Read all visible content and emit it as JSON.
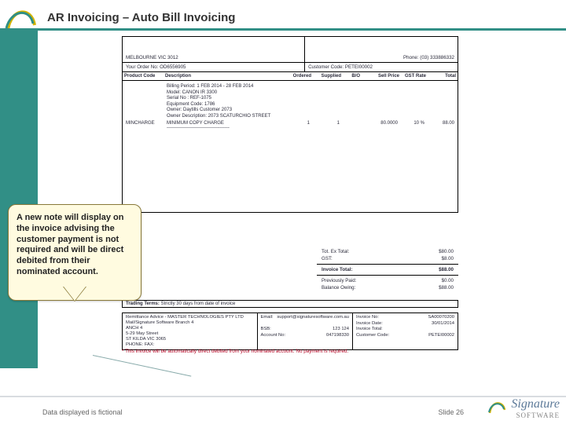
{
  "header": {
    "title": "AR Invoicing – Auto Bill Invoicing"
  },
  "invoice": {
    "melb_line": "MELBOURNE  VIC  3012",
    "phone": "Phone: (03) 333886332",
    "order_no_label": "Your Order No:",
    "order_no": "OD6556905",
    "cust_code_label": "Customer Code:",
    "cust_code": "PETEI00002",
    "cols": {
      "code": "Product Code",
      "desc": "Description",
      "ord": "Ordered",
      "sup": "Supplied",
      "bo": "B/O",
      "sell": "Sell Price",
      "gst": "GST Rate",
      "tot": "Total"
    },
    "detail": {
      "billing_period": "Billing Period: 1 FEB 2014 - 28 FEB 2014",
      "model": "Model: CANON IR 3300",
      "serial": "Serial No : REF-1075",
      "equip": "Equipment Code: 1786",
      "owner": "Owner: Daytills Customer 2073",
      "owner_desc": "Owner Description: 2073 SCATURCHIO STREET",
      "min_code": "MINCHARGE",
      "min_desc": "MINIMUM COPY CHARGE",
      "ord": "1",
      "sup": "1",
      "bo": "",
      "sell": "80.0000",
      "gst": "10 %",
      "tot": "88.00",
      "dashes": "----------------------------------------"
    },
    "totals": {
      "exgst_l": "Tot. Ex Total:",
      "exgst_v": "$80.00",
      "gst_l": "GST:",
      "gst_v": "$8.00",
      "invtot_l": "Invoice Total:",
      "invtot_v": "$88.00",
      "paid_l": "Previously Paid:",
      "paid_v": "$0.00",
      "owe_l": "Balance Owing:",
      "owe_v": "$88.00"
    },
    "terms_l": "Trading Terms:",
    "terms_v": "Strictly 30 days from date of invoice",
    "footer_left": {
      "l1": "Remittance Advice - MASTER TECHNOLOGIES PTY LTD",
      "l2": "Mail/Signature Software Branch 4",
      "l3": "ANCH 4",
      "l4": "5-29 May Street",
      "l5": "ST KILDA  VIC  3065",
      "l6": "PHONE:  FAX:"
    },
    "footer_mid": {
      "email_l": "Email:",
      "email_v": "support@signaturesoftware.com.au",
      "bsb_l": "BSB:",
      "bsb_v": "123 124",
      "acct_l": "Account No:",
      "acct_v": "047198330"
    },
    "footer_right": {
      "inv_l": "Invoice No:",
      "inv_v": "SA00070200",
      "date_l": "Invoice Date:",
      "date_v": "30/01/2014",
      "tot_l": "Invoice Total:",
      "cust_l": "Customer Code:",
      "cust_v": "PETEI00002"
    },
    "warning": "* This invoice will be automatically direct debited from your nominated account. No payment is required."
  },
  "callout": {
    "text": "A new note will display on the invoice advising the customer payment is not required and will be direct debited from their nominated account."
  },
  "footer": {
    "disclaimer": "Data displayed is fictional",
    "slide": "Slide 26",
    "brand1": "Signature",
    "brand2": "SOFTWARE"
  }
}
